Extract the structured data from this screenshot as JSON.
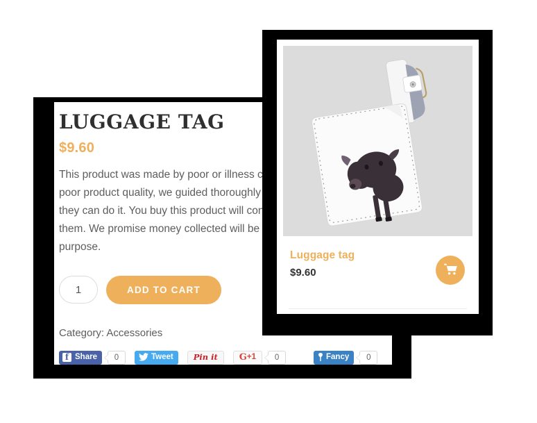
{
  "detail": {
    "title": "LUGGAGE TAG",
    "price": "$9.60",
    "description": "This product was made by poor or illness children. They are not poor product quality, we guided thoroughly to the children so that they can do it. You buy this product will contribute to our charities for them. We promise money collected will be used for the right purpose.",
    "quantity_value": "1",
    "quantity_placeholder": "1",
    "add_to_cart_label": "ADD TO CART",
    "category_label": "Category:",
    "category_value": "Accessories"
  },
  "share": {
    "facebook": {
      "label": "Share",
      "icon": "facebook-icon",
      "mark": "f",
      "count": "0"
    },
    "twitter": {
      "label": "Tweet",
      "icon": "twitter-bird-icon",
      "glyph": "🐦"
    },
    "pinterest": {
      "label": "Pin it",
      "icon": "pinterest-icon",
      "prefix": "P"
    },
    "googleplus": {
      "label": "+1",
      "icon": "google-plus-icon",
      "letter": "G",
      "count": "0"
    },
    "fancy": {
      "label": "Fancy",
      "icon": "fancy-icon",
      "glyph": "⚑",
      "count": "0"
    }
  },
  "thumbnail": {
    "name": "Luggage tag",
    "price": "$9.60",
    "cart_icon": "shopping-cart-icon",
    "image_alt": "white leather luggage tag printed with a cow"
  },
  "colors": {
    "accent_orange": "#efb05c",
    "facebook_blue": "#4a62a7",
    "twitter_blue": "#45aaf0",
    "pinterest_red": "#cb2027",
    "googleplus_red": "#db4437",
    "fancy_blue": "#3b82c4",
    "frame_black": "#000000",
    "text_grey": "#5d5d5d"
  }
}
